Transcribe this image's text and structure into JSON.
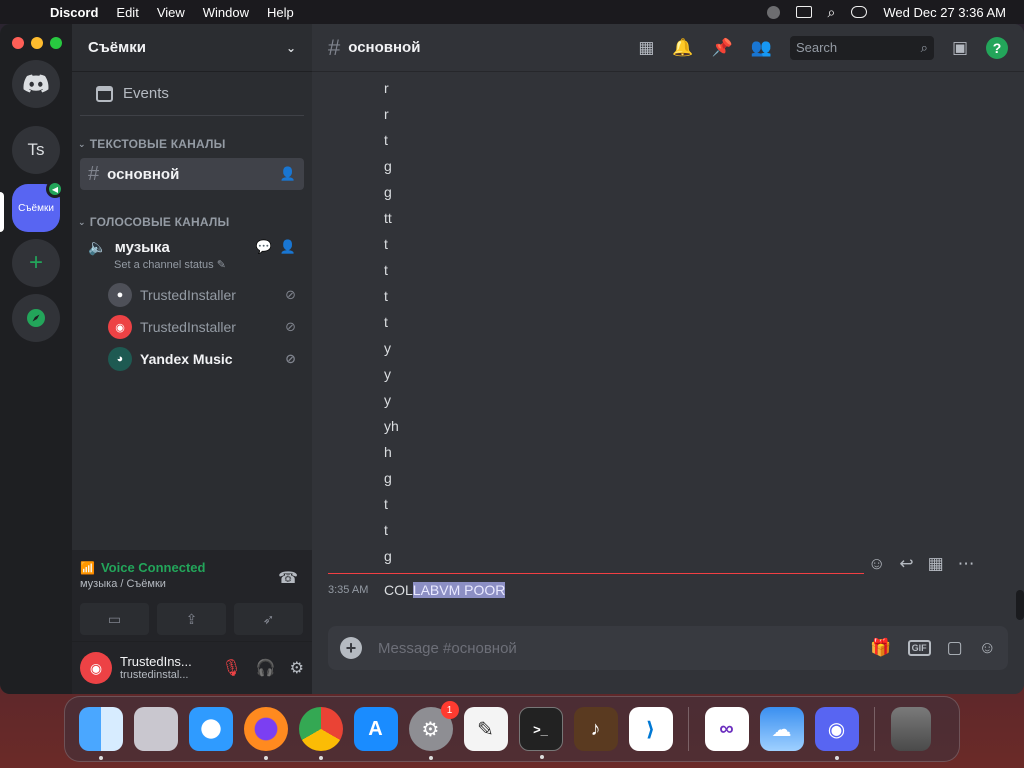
{
  "menubar": {
    "app": "Discord",
    "items": [
      "Edit",
      "View",
      "Window",
      "Help"
    ],
    "clock": "Wed Dec 27  3:36 AM"
  },
  "rail": {
    "server_ts": "Ts",
    "server_active": "Съёмки",
    "add_symbol": "+"
  },
  "sidebar": {
    "guild_name": "Съёмки",
    "events_label": "Events",
    "text_category": "ТЕКСТОВЫЕ КАНАЛЫ",
    "text_channel": "основной",
    "voice_category": "ГОЛОСОВЫЕ КАНАЛЫ",
    "voice_channel": "музыка",
    "voice_status": "Set a channel status",
    "voice_users": [
      {
        "name": "TrustedInstaller"
      },
      {
        "name": "TrustedInstaller"
      },
      {
        "name": "Yandex Music"
      }
    ]
  },
  "voice_panel": {
    "title": "Voice Connected",
    "subtitle": "музыка / Съёмки"
  },
  "user_panel": {
    "display_name": "TrustedIns...",
    "username": "trustedinstal..."
  },
  "channel": {
    "name": "основной",
    "search_placeholder": "Search",
    "help_symbol": "?"
  },
  "messages": {
    "lines": [
      "r",
      "r",
      "t",
      "g",
      "g",
      "tt",
      "t",
      "t",
      "t",
      "t",
      "y",
      "y",
      "y",
      "yh",
      "h",
      "g",
      "t",
      "t",
      "g"
    ],
    "last_time": "3:35 AM",
    "last_text_plain": "COL",
    "last_text_selected": "LABVM POOR"
  },
  "composer": {
    "placeholder": "Message #основной",
    "gif_label": "GIF"
  },
  "dock": {
    "settings_badge": "1"
  }
}
